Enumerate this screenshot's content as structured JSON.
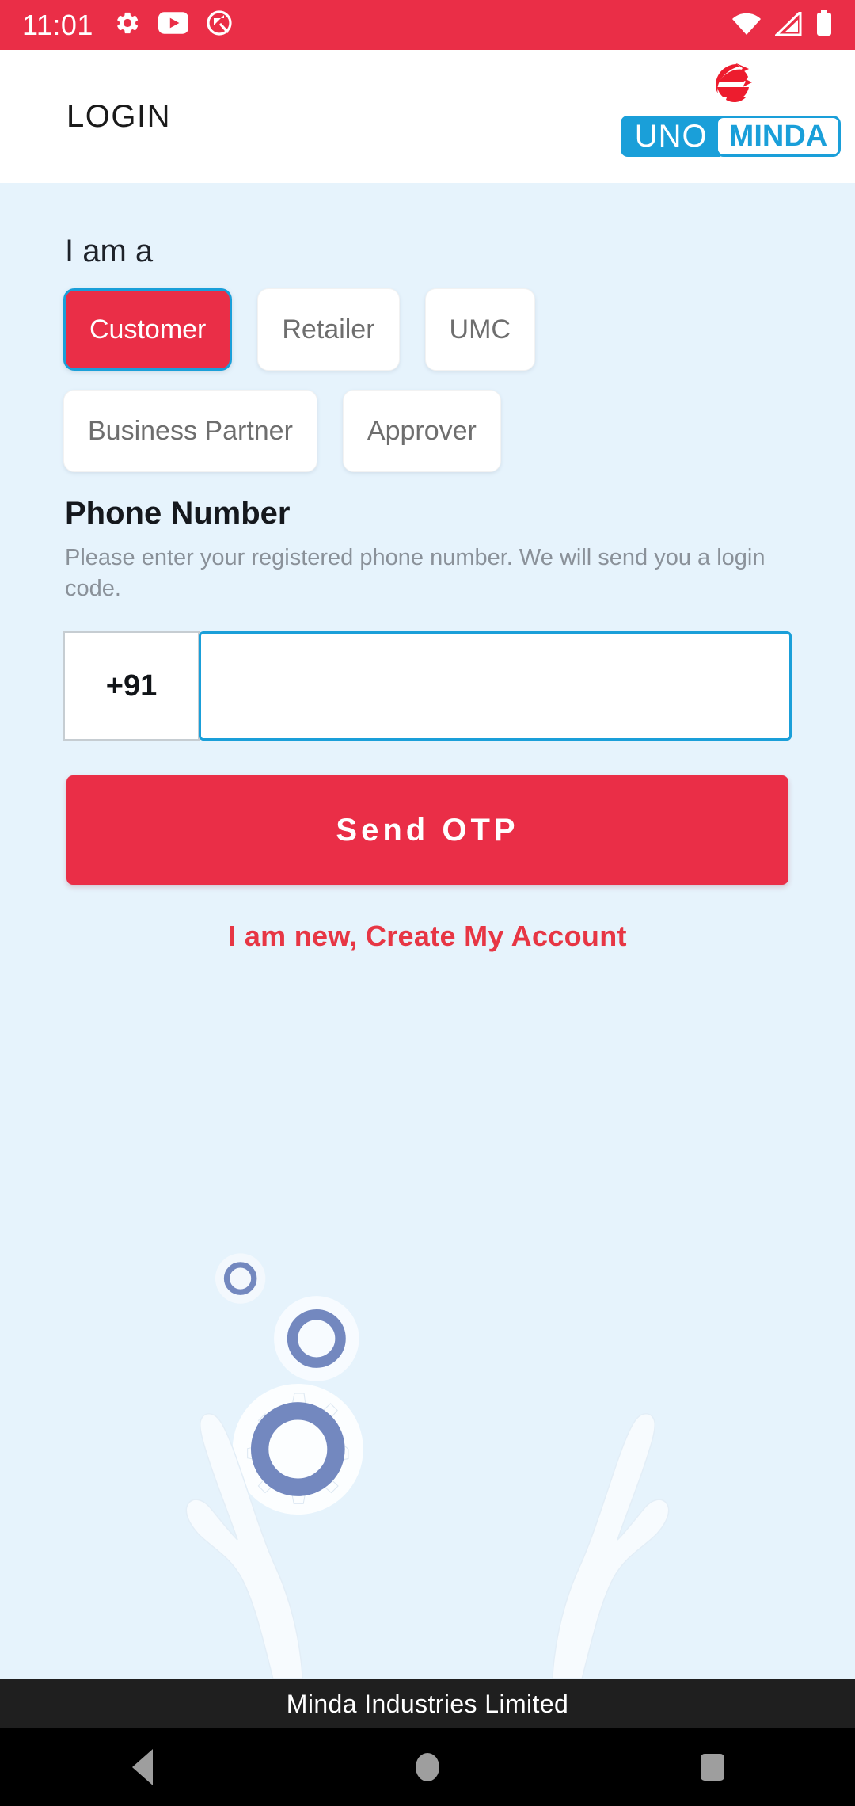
{
  "status_bar": {
    "time": "11:01",
    "left_icons": [
      "gear-icon",
      "youtube-icon",
      "circle-q-icon"
    ],
    "right_icons": [
      "wifi-icon",
      "cellular-signal-icon",
      "battery-icon"
    ],
    "background_color": "#ea2e47"
  },
  "app_bar": {
    "title": "LOGIN",
    "background_color": "#ffffff",
    "logo": {
      "part_one": "UNO",
      "part_two": "MINDA",
      "blue": "#1a9fd9",
      "red": "#ed1c2e"
    }
  },
  "form": {
    "role_section_label": "I am a",
    "roles": [
      {
        "label": "Customer",
        "selected": true
      },
      {
        "label": "Retailer",
        "selected": false
      },
      {
        "label": "UMC",
        "selected": false
      },
      {
        "label": "Business Partner",
        "selected": false
      },
      {
        "label": "Approver",
        "selected": false
      }
    ],
    "phone_label": "Phone Number",
    "phone_help": "Please enter your registered phone number. We will send you a login code.",
    "country_code": "+91",
    "phone_value": "",
    "phone_placeholder": "",
    "submit_label": "Send OTP",
    "create_account_label": "I am new, Create My Account",
    "accent_red": "#ea2e47",
    "accent_blue": "#1a9fd9",
    "background_color": "#e6f3fc"
  },
  "artwork": {
    "name": "hands-holding-gears-illustration",
    "gear_ring_color": "#7388bf",
    "gear_body_color": "#f7fbff"
  },
  "footer": {
    "company": "Minda Industries Limited",
    "background_color": "#1f1f1f"
  },
  "nav_bar": {
    "back": "back-button",
    "home": "home-button",
    "recents": "recents-button"
  }
}
